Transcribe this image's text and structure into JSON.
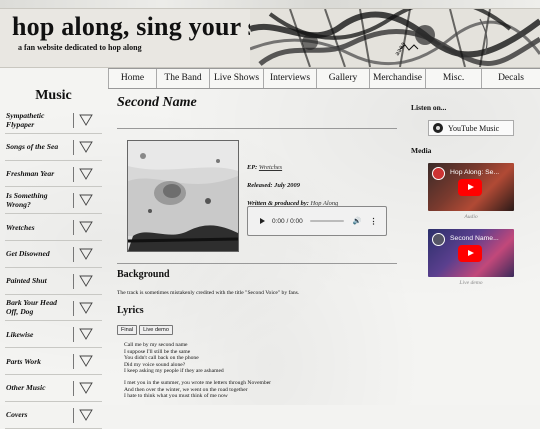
{
  "header": {
    "title": "hop along, sing your song",
    "subtitle": "a fan website dedicated to hop along"
  },
  "nav": {
    "items": [
      {
        "label": "Home"
      },
      {
        "label": "The Band"
      },
      {
        "label": "Live Shows"
      },
      {
        "label": "Interviews"
      },
      {
        "label": "Gallery"
      },
      {
        "label": "Merchandise"
      },
      {
        "label": "Misc."
      },
      {
        "label": "Decals"
      }
    ]
  },
  "sidebar": {
    "title": "Music",
    "items": [
      {
        "label": "Sympathetic Flypaper"
      },
      {
        "label": "Songs of the Sea"
      },
      {
        "label": "Freshman Year"
      },
      {
        "label": "Is Something Wrong?"
      },
      {
        "label": "Wretches"
      },
      {
        "label": "Get Disowned"
      },
      {
        "label": "Painted Shut"
      },
      {
        "label": "Bark Your Head Off, Dog"
      },
      {
        "label": "Likewise"
      },
      {
        "label": "Parts Work"
      },
      {
        "label": "Other Music"
      },
      {
        "label": "Covers"
      }
    ]
  },
  "main": {
    "title": "Second Name",
    "meta": {
      "ep_label": "EP:",
      "ep_value": "Wretches",
      "released": "Released: July 2009",
      "credit_label": "Written & produced by:",
      "credit_value": "Hop Along"
    },
    "audio": {
      "time": "0:00 / 0:00"
    },
    "background_heading": "Background",
    "background_text": "The track is sometimes mistakenly credited with the title \"Second Voice\" by fans.",
    "lyrics_heading": "Lyrics",
    "lyric_tabs": [
      "Final",
      "Live demo"
    ],
    "lyrics_stanza1": [
      "Call me by my second name",
      "I suppose I'll still be the same",
      "You didn't call back on the phone",
      "Did my voice sound alone?",
      "I keep asking my people if they are ashamed"
    ],
    "lyrics_stanza2": [
      "I met you in the summer, you wrote me letters through November",
      "And then over the winter, we went on the road together",
      "I hate to think what you must think of me now"
    ]
  },
  "right": {
    "listen_heading": "Listen on...",
    "youtube_music_label": "YouTube Music",
    "media_heading": "Media",
    "videos": [
      {
        "title": "Hop Along: Se...",
        "caption": "Audio"
      },
      {
        "title": "Second Name...",
        "caption": "Live demo"
      }
    ]
  }
}
